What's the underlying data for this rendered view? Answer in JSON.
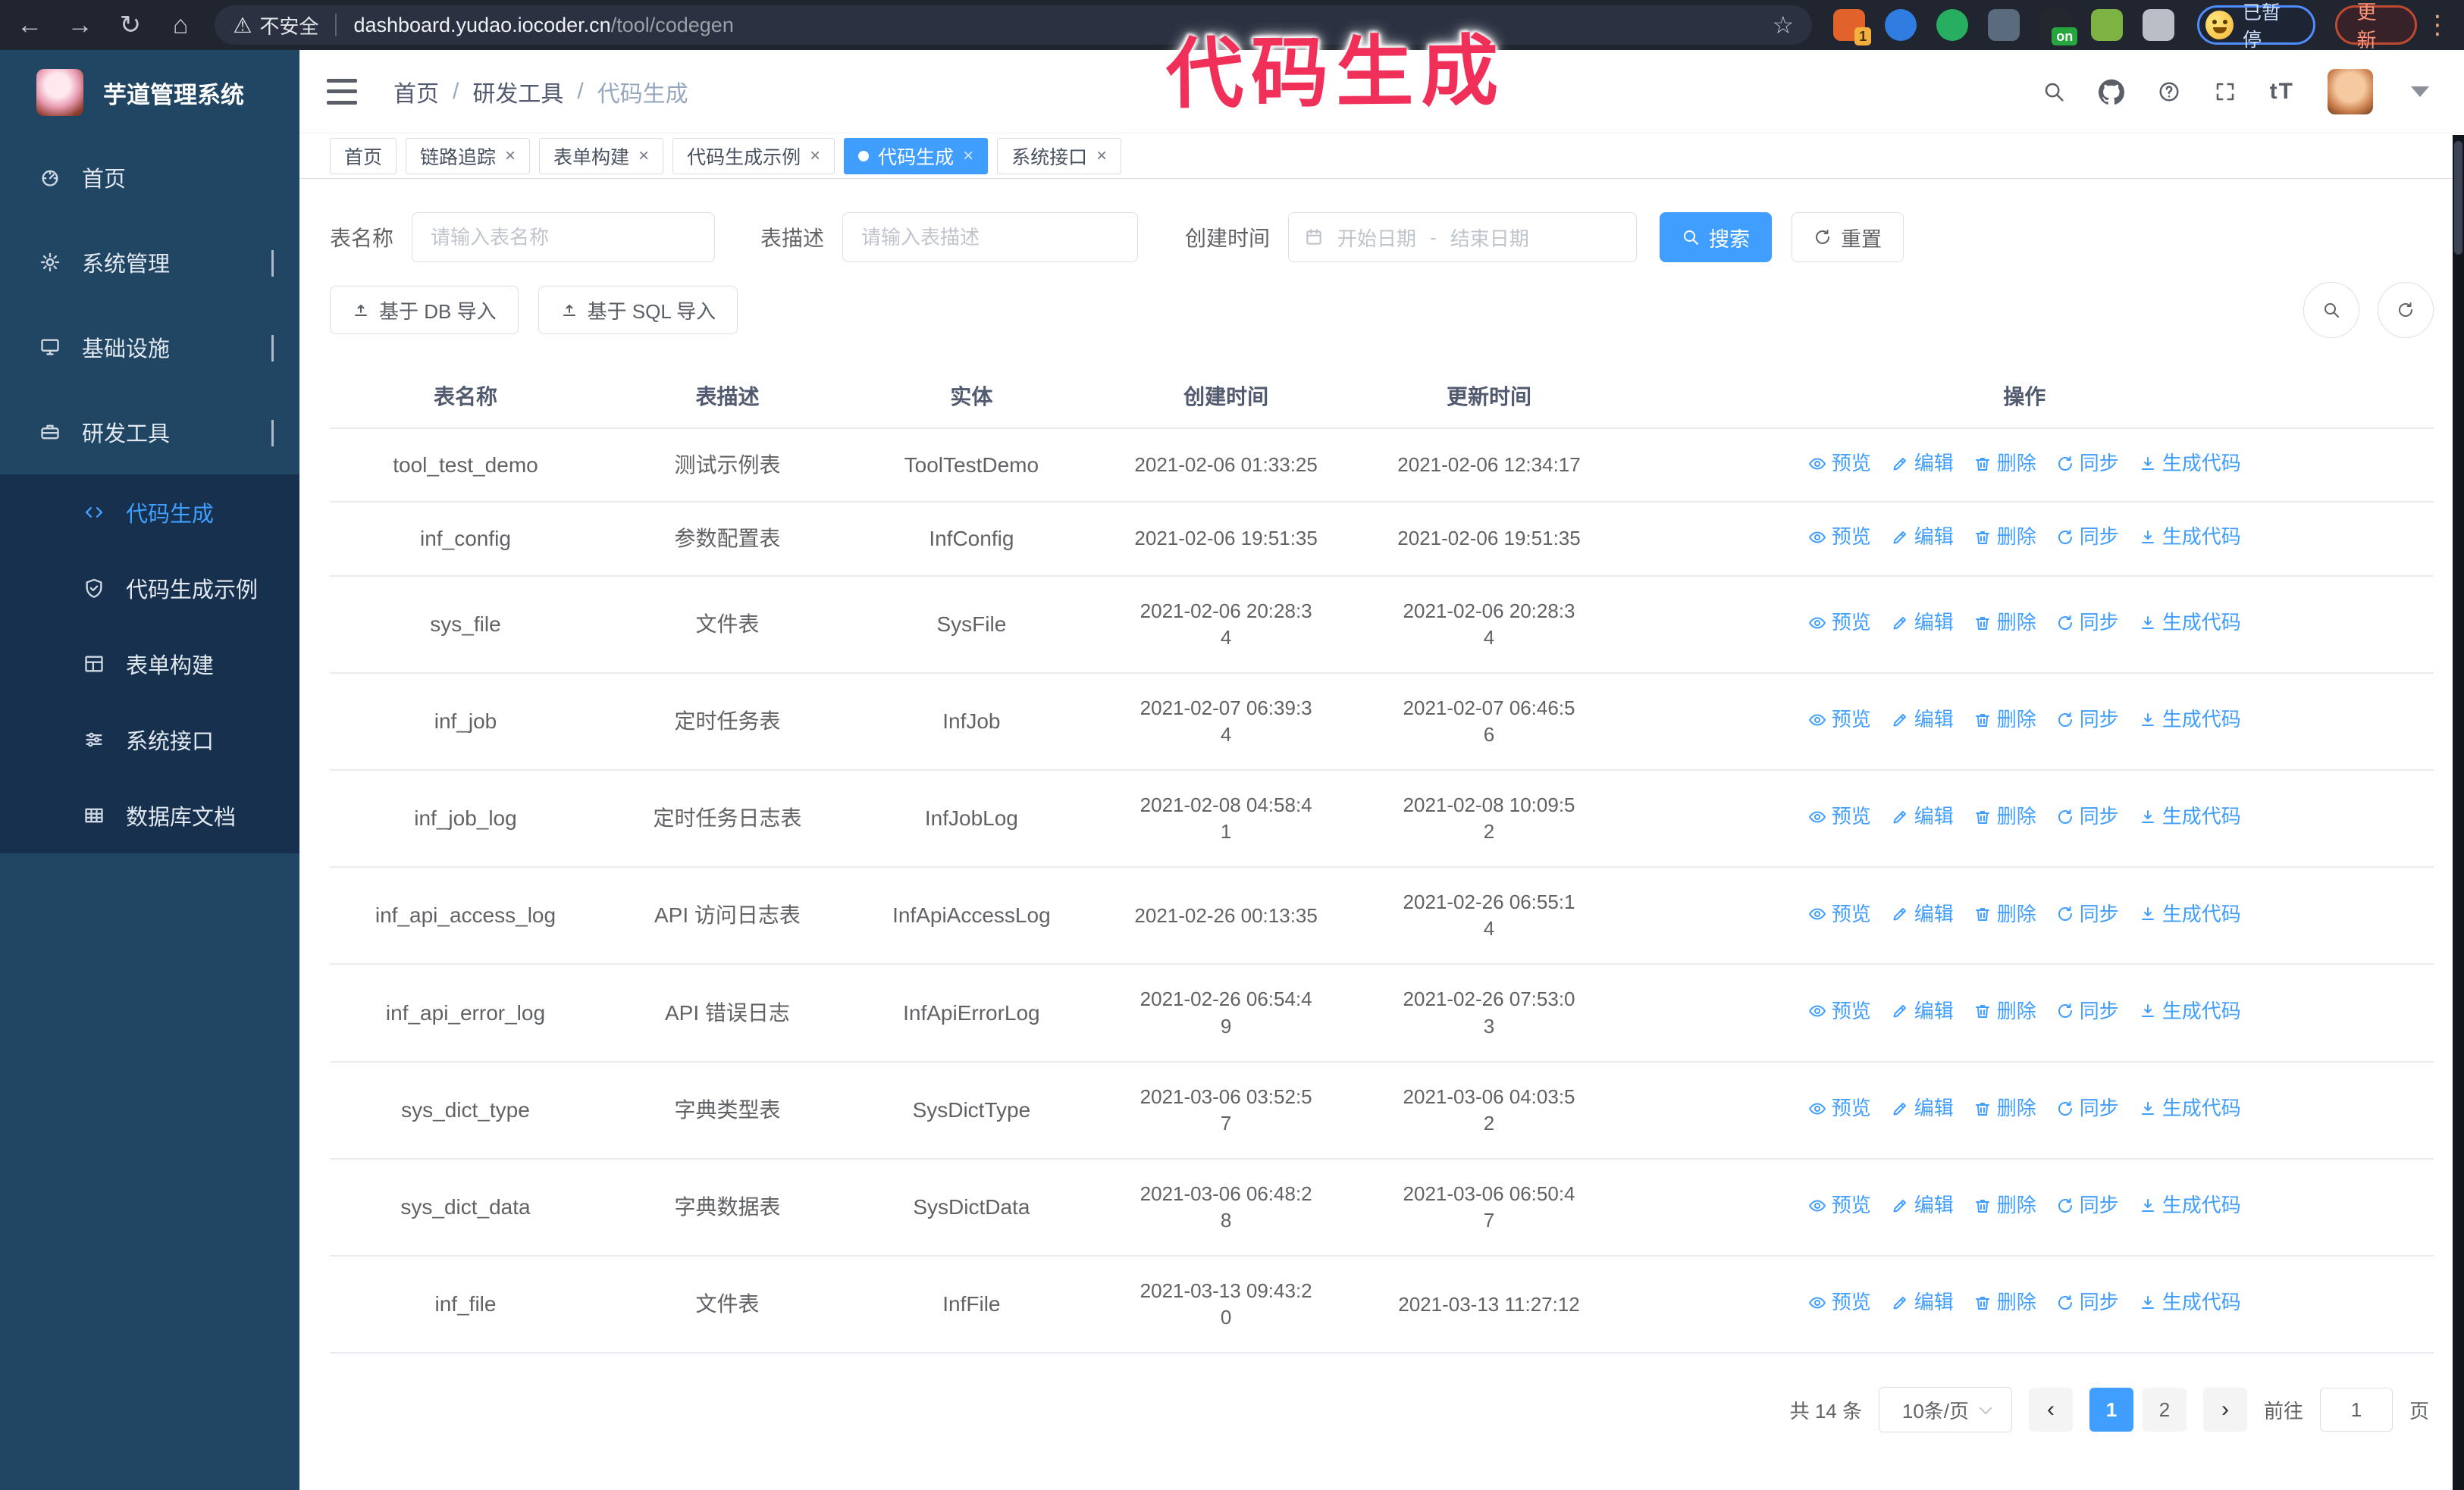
{
  "colors": {
    "accent": "#409eff",
    "annotation": "#f03059",
    "sidebar": "#214663",
    "submenu": "#16304d"
  },
  "annotation": {
    "text": "代码生成"
  },
  "browser": {
    "security_warning": "不安全",
    "url_host": "dashboard.yudao.iocoder.cn",
    "url_path": "/tool/codegen",
    "profile_label": "已暂停",
    "update_label": "更新",
    "extensions": [
      {
        "name": "extension-orange",
        "color": "#e2622b",
        "badge": "1"
      },
      {
        "name": "extension-gem",
        "color": "#2f7de1",
        "badge": ""
      },
      {
        "name": "extension-check",
        "color": "#27ae60",
        "badge": ""
      },
      {
        "name": "extension-grid",
        "color": "#5a6b7d",
        "badge": ""
      },
      {
        "name": "extension-onoff",
        "color": "#23272e",
        "badge": "on"
      },
      {
        "name": "extension-bot",
        "color": "#7cb342",
        "badge": ""
      },
      {
        "name": "extension-puzzle",
        "color": "#b9bec7",
        "badge": ""
      }
    ]
  },
  "sidebar": {
    "title": "芋道管理系统",
    "items": [
      {
        "label": "首页",
        "icon": "dashboard-icon",
        "chevron": ""
      },
      {
        "label": "系统管理",
        "icon": "gear-icon",
        "chevron": "down"
      },
      {
        "label": "基础设施",
        "icon": "monitor-icon",
        "chevron": "down"
      },
      {
        "label": "研发工具",
        "icon": "toolbox-icon",
        "chevron": "up"
      }
    ],
    "subitems": [
      {
        "label": "代码生成",
        "icon": "code-icon",
        "active": true
      },
      {
        "label": "代码生成示例",
        "icon": "shield-icon",
        "active": false
      },
      {
        "label": "表单构建",
        "icon": "form-icon",
        "active": false
      },
      {
        "label": "系统接口",
        "icon": "sliders-icon",
        "active": false
      },
      {
        "label": "数据库文档",
        "icon": "database-icon",
        "active": false
      }
    ]
  },
  "header": {
    "breadcrumb": [
      "首页",
      "研发工具",
      "代码生成"
    ]
  },
  "tabs": [
    {
      "label": "首页",
      "closable": false,
      "active": false
    },
    {
      "label": "链路追踪",
      "closable": true,
      "active": false
    },
    {
      "label": "表单构建",
      "closable": true,
      "active": false
    },
    {
      "label": "代码生成示例",
      "closable": true,
      "active": false
    },
    {
      "label": "代码生成",
      "closable": true,
      "active": true
    },
    {
      "label": "系统接口",
      "closable": true,
      "active": false
    }
  ],
  "filters": {
    "name_label": "表名称",
    "name_placeholder": "请输入表名称",
    "desc_label": "表描述",
    "desc_placeholder": "请输入表描述",
    "time_label": "创建时间",
    "start_placeholder": "开始日期",
    "range_separator": "-",
    "end_placeholder": "结束日期",
    "search_label": "搜索",
    "reset_label": "重置"
  },
  "toolbar": {
    "import_db_label": "基于 DB 导入",
    "import_sql_label": "基于 SQL 导入"
  },
  "table": {
    "columns": [
      "表名称",
      "表描述",
      "实体",
      "创建时间",
      "更新时间",
      "操作"
    ],
    "actions": [
      {
        "label": "预览",
        "icon": "eye-icon"
      },
      {
        "label": "编辑",
        "icon": "edit-icon"
      },
      {
        "label": "删除",
        "icon": "delete-icon"
      },
      {
        "label": "同步",
        "icon": "sync-icon"
      },
      {
        "label": "生成代码",
        "icon": "download-icon"
      }
    ],
    "rows": [
      {
        "name": "tool_test_demo",
        "desc": "测试示例表",
        "entity": "ToolTestDemo",
        "created": "2021-02-06 01:33:25",
        "updated": "2021-02-06 12:34:17"
      },
      {
        "name": "inf_config",
        "desc": "参数配置表",
        "entity": "InfConfig",
        "created": "2021-02-06 19:51:35",
        "updated": "2021-02-06 19:51:35"
      },
      {
        "name": "sys_file",
        "desc": "文件表",
        "entity": "SysFile",
        "created": "2021-02-06 20:28:3\n4",
        "updated": "2021-02-06 20:28:3\n4"
      },
      {
        "name": "inf_job",
        "desc": "定时任务表",
        "entity": "InfJob",
        "created": "2021-02-07 06:39:3\n4",
        "updated": "2021-02-07 06:46:5\n6"
      },
      {
        "name": "inf_job_log",
        "desc": "定时任务日志表",
        "entity": "InfJobLog",
        "created": "2021-02-08 04:58:4\n1",
        "updated": "2021-02-08 10:09:5\n2"
      },
      {
        "name": "inf_api_access_log",
        "desc": "API 访问日志表",
        "entity": "InfApiAccessLog",
        "created": "2021-02-26 00:13:35",
        "updated": "2021-02-26 06:55:1\n4"
      },
      {
        "name": "inf_api_error_log",
        "desc": "API 错误日志",
        "entity": "InfApiErrorLog",
        "created": "2021-02-26 06:54:4\n9",
        "updated": "2021-02-26 07:53:0\n3"
      },
      {
        "name": "sys_dict_type",
        "desc": "字典类型表",
        "entity": "SysDictType",
        "created": "2021-03-06 03:52:5\n7",
        "updated": "2021-03-06 04:03:5\n2"
      },
      {
        "name": "sys_dict_data",
        "desc": "字典数据表",
        "entity": "SysDictData",
        "created": "2021-03-06 06:48:2\n8",
        "updated": "2021-03-06 06:50:4\n7"
      },
      {
        "name": "inf_file",
        "desc": "文件表",
        "entity": "InfFile",
        "created": "2021-03-13 09:43:2\n0",
        "updated": "2021-03-13 11:27:12"
      }
    ]
  },
  "pagination": {
    "total_label": "共 14 条",
    "page_size": "10条/页",
    "pages": [
      {
        "label": "1",
        "active": true
      },
      {
        "label": "2",
        "active": false
      }
    ],
    "goto_label": "前往",
    "goto_value": "1",
    "page_unit": "页"
  }
}
